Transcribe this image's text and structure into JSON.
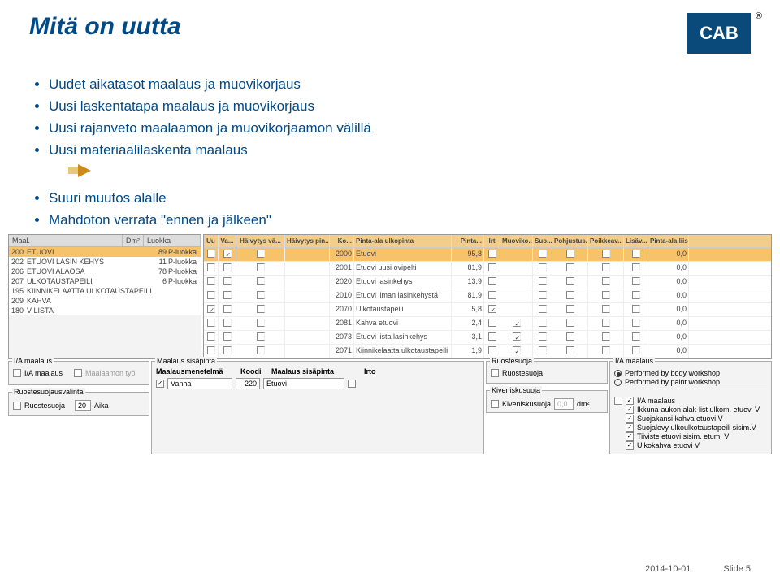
{
  "header": {
    "title": "Mitä on uutta",
    "logo_text": "CAB",
    "reg": "®"
  },
  "bullets": {
    "group1": [
      "Uudet aikatasot maalaus ja muovikorjaus",
      "Uusi laskentatapa maalaus ja muovikorjaus",
      "Uusi rajanveto maalaamon ja muovikorjaamon välillä",
      "Uusi materiaalilaskenta maalaus"
    ],
    "group2": [
      "Suuri muutos alalle",
      "Mahdoton verrata \"ennen ja jälkeen\""
    ]
  },
  "left_panel": {
    "headers": {
      "maal": "Maal.",
      "dm": "Dm²",
      "luokka": "Luokka"
    },
    "rows": [
      {
        "code": "200",
        "desc": "ETUOVI",
        "dm": "89",
        "cl": "P-luokka",
        "sel": true
      },
      {
        "code": "202",
        "desc": "ETUOVI LASIN KEHYS",
        "dm": "11",
        "cl": "P-luokka"
      },
      {
        "code": "206",
        "desc": "ETUOVI ALAOSA",
        "dm": "78",
        "cl": "P-luokka"
      },
      {
        "code": "207",
        "desc": "ULKOTAUSTAPEILI",
        "dm": "6",
        "cl": "P-luokka"
      },
      {
        "code": "195",
        "desc": "KIINNIKELAATTA ULKOTAUSTAPEILI",
        "dm": "",
        "cl": ""
      },
      {
        "code": "209",
        "desc": "KAHVA",
        "dm": "",
        "cl": ""
      },
      {
        "code": "180",
        "desc": "V LISTA",
        "dm": "",
        "cl": ""
      }
    ]
  },
  "right_panel": {
    "headers": [
      "Uu",
      "Va...",
      "Häivytys vä...",
      "Häivytys pin...",
      "Ko...",
      "Pinta-ala ulkopinta",
      "Pinta...",
      "Irt",
      "Muoviko...",
      "Suo...",
      "Pohjustus...",
      "Poikkeav...",
      "Lisäv...",
      "Pinta-ala liis..."
    ],
    "rows": [
      {
        "uu": false,
        "va": true,
        "hva": false,
        "hpi": "",
        "ko": "2000",
        "pa": "Etuovi",
        "pi": "95,8",
        "irt": false,
        "mu": "",
        "su": false,
        "po": false,
        "pk": false,
        "li": false,
        "pal": "0,0",
        "sel": true
      },
      {
        "uu": false,
        "va": false,
        "hva": false,
        "hpi": "",
        "ko": "2001",
        "pa": "Etuovi uusi ovipelti",
        "pi": "81,9",
        "irt": false,
        "mu": "",
        "su": false,
        "po": false,
        "pk": false,
        "li": false,
        "pal": "0,0"
      },
      {
        "uu": false,
        "va": false,
        "hva": false,
        "hpi": "",
        "ko": "2020",
        "pa": "Etuovi lasinkehys",
        "pi": "13,9",
        "irt": false,
        "mu": "",
        "su": false,
        "po": false,
        "pk": false,
        "li": false,
        "pal": "0,0"
      },
      {
        "uu": false,
        "va": false,
        "hva": false,
        "hpi": "",
        "ko": "2010",
        "pa": "Etuovi ilman lasinkehystä",
        "pi": "81,9",
        "irt": false,
        "mu": "",
        "su": false,
        "po": false,
        "pk": false,
        "li": false,
        "pal": "0,0"
      },
      {
        "uu": true,
        "va": false,
        "hva": false,
        "hpi": "",
        "ko": "2070",
        "pa": "Ulkotaustapeili",
        "pi": "5,8",
        "irt": true,
        "mu": "",
        "su": false,
        "po": false,
        "pk": false,
        "li": false,
        "pal": "0,0"
      },
      {
        "uu": false,
        "va": false,
        "hva": false,
        "hpi": "",
        "ko": "2081",
        "pa": "Kahva etuovi",
        "pi": "2,4",
        "irt": false,
        "mu": true,
        "su": false,
        "po": false,
        "pk": false,
        "li": false,
        "pal": "0,0"
      },
      {
        "uu": false,
        "va": false,
        "hva": false,
        "hpi": "",
        "ko": "2073",
        "pa": "Etuovi lista lasinkehys",
        "pi": "3,1",
        "irt": false,
        "mu": true,
        "su": false,
        "po": false,
        "pk": false,
        "li": false,
        "pal": "0,0"
      },
      {
        "uu": false,
        "va": false,
        "hva": false,
        "hpi": "",
        "ko": "2071",
        "pa": "Kiinnikelaatta ulkotaustapeili",
        "pi": "1,9",
        "irt": false,
        "mu": true,
        "su": false,
        "po": false,
        "pk": false,
        "li": false,
        "pal": "0,0"
      }
    ]
  },
  "bottom": {
    "ia": {
      "title": "I/A maalaus",
      "l1": "I/A maalaus",
      "l2": "Maalaamon työ"
    },
    "rs": {
      "title": "Ruostesuojausvalinta",
      "label": "Ruostesuoja",
      "val": "20",
      "aika": "Aika"
    },
    "ms": {
      "title": "Maalaus sisäpinta",
      "h1": "Maalausmenetelmä",
      "h2": "Koodi",
      "h3": "Maalaus sisäpinta",
      "h4": "Irto",
      "mval": "Vanha",
      "kval": "220",
      "sval": "Etuovi"
    },
    "rsj": {
      "title": "Ruostesuoja",
      "label": "Ruostesuoja"
    },
    "kv": {
      "title": "Kiveniskusuoja",
      "label": "Kiveniskusuoja",
      "val": "0,0",
      "unit": "dm²"
    },
    "ia2": {
      "title": "I/A maalaus",
      "r1": "Performed by body workshop",
      "r2": "Performed by paint workshop",
      "cbmain": "I/A maalaus",
      "items": [
        "Ikkuna-aukon alak-list ulkom. etuovi V",
        "Suojakansi kahva etuovi V",
        "Suojalevy ulkoulkotaustapeili sisim.V",
        "Tiiviste etuovi sisim. etum. V",
        "Ulkokahva etuovi V"
      ]
    }
  },
  "footer": {
    "date": "2014-10-01",
    "slide": "Slide 5"
  }
}
